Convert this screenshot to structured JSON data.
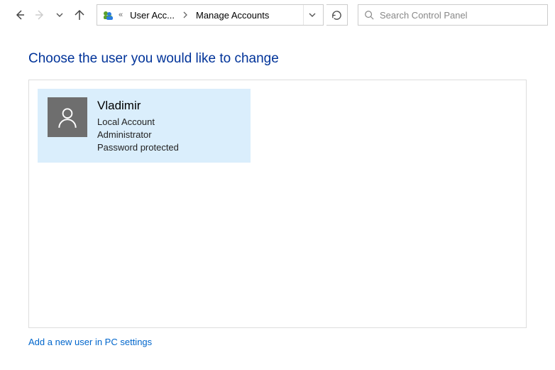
{
  "nav": {
    "back_enabled": true,
    "forward_enabled": false
  },
  "address": {
    "prefix_glyph": "«",
    "segments": [
      "User Acc...",
      "Manage Accounts"
    ]
  },
  "search": {
    "placeholder": "Search Control Panel"
  },
  "heading": "Choose the user you would like to change",
  "users": [
    {
      "name": "Vladimir",
      "lines": [
        "Local Account",
        "Administrator",
        "Password protected"
      ]
    }
  ],
  "footer_link": "Add a new user in PC settings"
}
